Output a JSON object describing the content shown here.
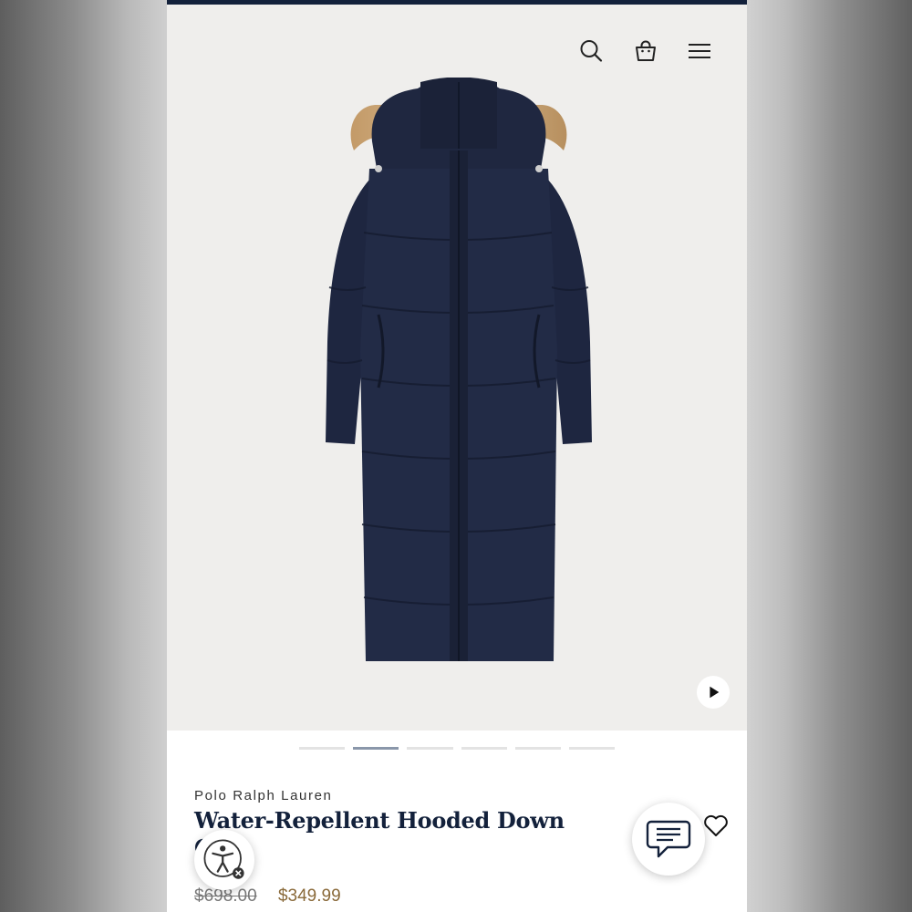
{
  "header": {
    "search_icon": "search-icon",
    "bag_icon": "shopping-bag-icon",
    "menu_icon": "hamburger-menu-icon"
  },
  "gallery": {
    "image": "navy long puffer coat with fur-trimmed hood",
    "video_icon": "play-icon",
    "slide_count": 6,
    "active_slide": 2
  },
  "product": {
    "brand": "Polo Ralph Lauren",
    "title": "Water-Repellent Hooded Down Coat",
    "price_original": "$698.00",
    "price_sale": "$349.99"
  },
  "floating": {
    "chat_icon": "chat-bubble-icon",
    "wishlist_icon": "heart-icon",
    "accessibility_icon": "accessibility-icon"
  },
  "colors": {
    "navy": "#13213b",
    "sale_price": "#8a6a3a",
    "hero_bg": "#efeeec"
  }
}
